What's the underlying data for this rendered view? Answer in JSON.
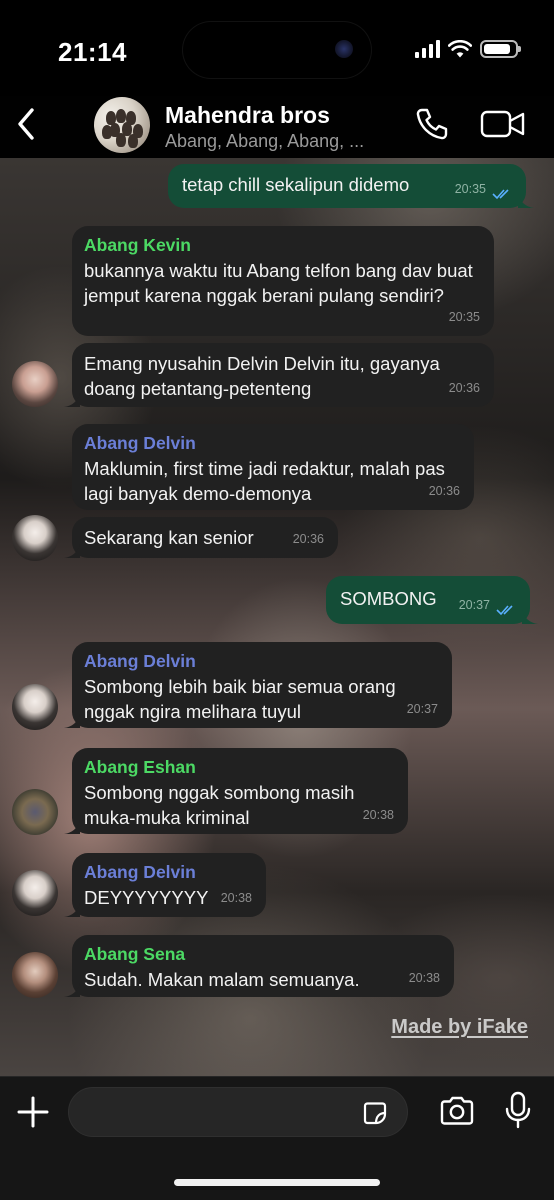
{
  "status_bar": {
    "time": "21:14",
    "battery_level": 0.85
  },
  "header": {
    "title": "Mahendra bros",
    "subtitle": "Abang, Abang, Abang, ..."
  },
  "colors": {
    "outgoing_bubble": "#144d37",
    "incoming_bubble": "#212121",
    "sender_green": "#4cd964",
    "sender_blue": "#6b7fd7",
    "read_ticks": "#5ab0ff"
  },
  "messages": [
    {
      "direction": "out",
      "text": "tetap chill sekalipun didemo",
      "time": "20:35",
      "read": true
    },
    {
      "direction": "in",
      "sender": "Abang Kevin",
      "text": "bukannya waktu itu Abang telfon bang dav buat jemput karena nggak berani pulang sendiri?",
      "time": "20:35"
    },
    {
      "direction": "in",
      "text": "Emang nyusahin Delvin Delvin itu, gayanya doang petantang-petenteng",
      "time": "20:36"
    },
    {
      "direction": "in",
      "sender": "Abang Delvin",
      "text": "Maklumin, first time jadi redaktur, malah pas lagi banyak demo-demonya",
      "time": "20:36"
    },
    {
      "direction": "in",
      "text": "Sekarang kan senior",
      "time": "20:36"
    },
    {
      "direction": "out",
      "text": "SOMBONG",
      "time": "20:37",
      "read": true
    },
    {
      "direction": "in",
      "sender": "Abang Delvin",
      "text": "Sombong lebih baik biar semua orang nggak ngira melihara tuyul",
      "time": "20:37"
    },
    {
      "direction": "in",
      "sender": "Abang Eshan",
      "text": "Sombong nggak sombong masih muka-muka kriminal",
      "time": "20:38"
    },
    {
      "direction": "in",
      "sender": "Abang Delvin",
      "text": "DEYYYYYYYY",
      "time": "20:38"
    },
    {
      "direction": "in",
      "sender": "Abang Sena",
      "text": "Sudah. Makan malam semuanya.",
      "time": "20:38"
    }
  ],
  "watermark": "Made by iFake",
  "composer": {
    "placeholder": "",
    "value": ""
  },
  "icons": [
    "back-chevron-icon",
    "phone-icon",
    "video-camera-icon",
    "plus-icon",
    "sticker-icon",
    "camera-icon",
    "microphone-icon"
  ]
}
